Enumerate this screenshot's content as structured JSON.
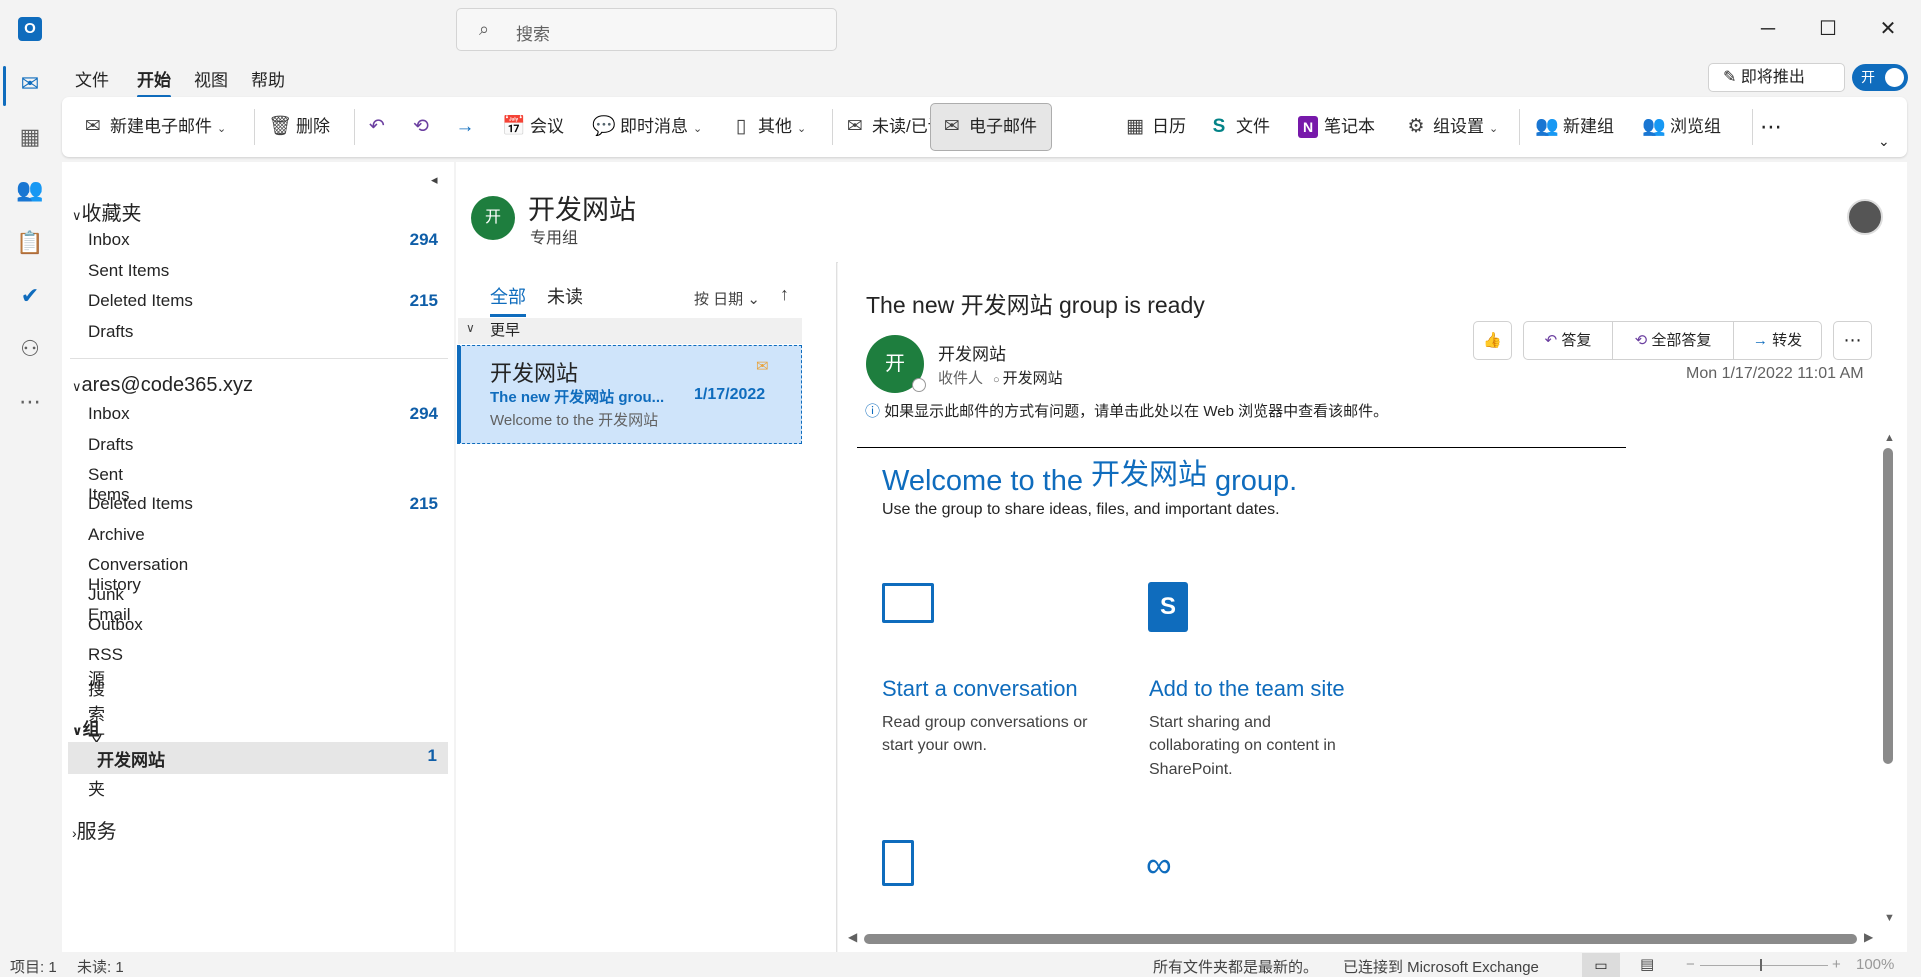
{
  "window": {
    "search_placeholder": "搜索"
  },
  "menu": {
    "tabs": [
      "文件",
      "开始",
      "视图",
      "帮助"
    ],
    "coming_soon": "即将推出",
    "toggle": "开"
  },
  "ribbon": {
    "new_email": "新建电子邮件",
    "delete": "删除",
    "meeting": "会议",
    "im": "即时消息",
    "other": "其他",
    "read_unread": "未读/已读",
    "email": "电子邮件",
    "calendar": "日历",
    "files": "文件",
    "notebook": "笔记本",
    "group_settings": "组设置",
    "new_group": "新建组",
    "browse_groups": "浏览组"
  },
  "folders": {
    "favorites": {
      "title": "收藏夹",
      "items": [
        {
          "name": "Inbox",
          "count": "294"
        },
        {
          "name": "Sent Items",
          "count": ""
        },
        {
          "name": "Deleted Items",
          "count": "215"
        },
        {
          "name": "Drafts",
          "count": ""
        }
      ]
    },
    "account": {
      "title": "ares@code365.xyz",
      "items": [
        {
          "name": "Inbox",
          "count": "294"
        },
        {
          "name": "Drafts",
          "count": ""
        },
        {
          "name": "Sent Items",
          "count": ""
        },
        {
          "name": "Deleted Items",
          "count": "215"
        },
        {
          "name": "Archive",
          "count": ""
        },
        {
          "name": "Conversation History",
          "count": ""
        },
        {
          "name": "Junk Email",
          "count": ""
        },
        {
          "name": "Outbox",
          "count": ""
        },
        {
          "name": "RSS 源",
          "count": ""
        },
        {
          "name": "搜索文件夹",
          "count": ""
        }
      ]
    },
    "groups": {
      "title": "组",
      "items": [
        {
          "name": "开发网站",
          "count": "1"
        }
      ]
    },
    "services": {
      "title": "服务"
    }
  },
  "group_header": {
    "avatar": "开",
    "name": "开发网站",
    "type": "专用组"
  },
  "message_list": {
    "tabs": [
      "全部",
      "未读"
    ],
    "sort": "按 日期",
    "group_label": "更早",
    "items": [
      {
        "sender": "开发网站",
        "subject": "The new 开发网站 grou...",
        "date": "1/17/2022",
        "preview": "Welcome to the 开发网站"
      }
    ]
  },
  "reading": {
    "subject": "The new 开发网站 group is ready",
    "avatar": "开",
    "sender": "开发网站",
    "to_label": "收件人",
    "to": "开发网站",
    "date": "Mon 1/17/2022 11:01 AM",
    "info": "如果显示此邮件的方式有问题，请单击此处以在 Web 浏览器中查看该邮件。",
    "reply": "答复",
    "reply_all": "全部答复",
    "forward": "转发",
    "body": {
      "welcome_prefix": "Welcome to the",
      "welcome_name": "开发网站",
      "welcome_suffix": "group.",
      "intro": "Use the group to share ideas, files, and important dates.",
      "card1_title": "Start a conversation",
      "card1_text1": "Read group conversations or",
      "card1_text2": "start your own.",
      "card2_title": "Add to the team site",
      "card2_text1": "Start sharing and",
      "card2_text2": "collaborating on content in",
      "card2_text3": "SharePoint."
    }
  },
  "status": {
    "items": "项目: 1",
    "unread": "未读: 1",
    "sync": "所有文件夹都是最新的。",
    "connected": "已连接到 Microsoft Exchange",
    "zoom": "100%"
  },
  "colors": {
    "accent": "#0f6cbd",
    "group_avatar": "#1e7e3e"
  }
}
